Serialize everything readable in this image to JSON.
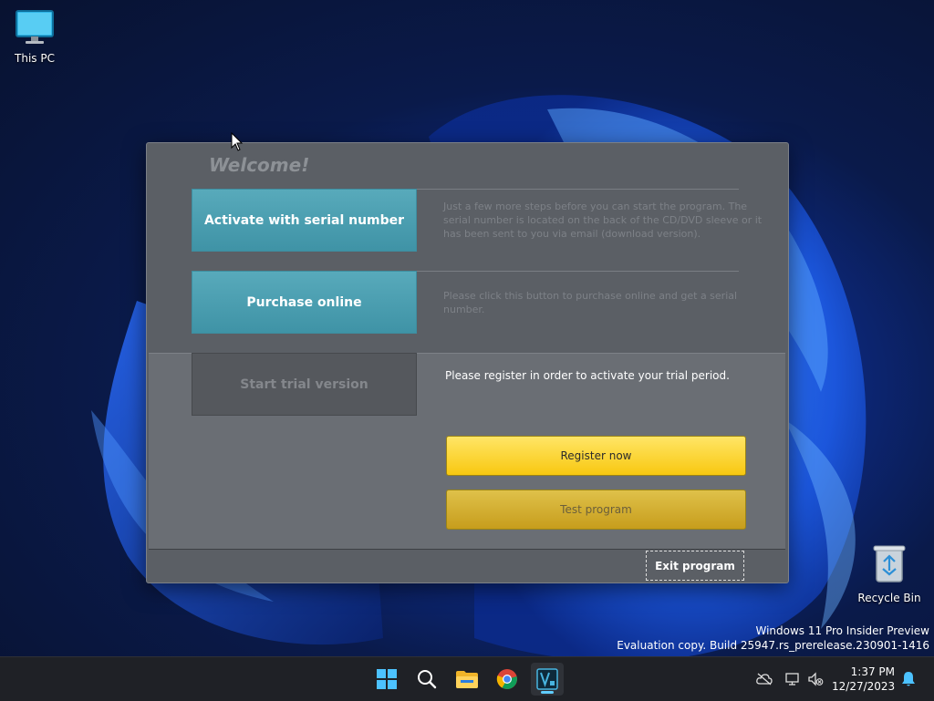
{
  "desktop": {
    "icons": [
      {
        "label": "This PC"
      },
      {
        "label": "Recycle Bin"
      }
    ],
    "watermark": {
      "line1": "Windows 11 Pro Insider Preview",
      "line2": "Evaluation copy. Build 25947.rs_prerelease.230901-1416"
    }
  },
  "dialog": {
    "welcome": "Welcome!",
    "activate_button": "Activate with serial number",
    "activate_desc": "Just a few more steps before you can start the program. The serial number is located on the back of the CD/DVD sleeve or it has been sent to you via email (download version).",
    "purchase_button": "Purchase online",
    "purchase_desc": "Please click this button to purchase online and get a serial number.",
    "trial_button": "Start trial version",
    "trial_text": "Please register in order to activate your trial period.",
    "register_button": "Register now",
    "test_button": "Test program",
    "exit_button": "Exit program"
  },
  "taskbar": {
    "items": [
      "start-icon",
      "search-icon",
      "file-explorer-icon",
      "chrome-icon",
      "vegas-app-icon"
    ],
    "clock": {
      "time": "1:37 PM",
      "date": "12/27/2023"
    }
  },
  "colors": {
    "teal_button": "#4aa0b2",
    "yellow_button": "#f8c810",
    "dialog_bg": "#5b5f65"
  }
}
